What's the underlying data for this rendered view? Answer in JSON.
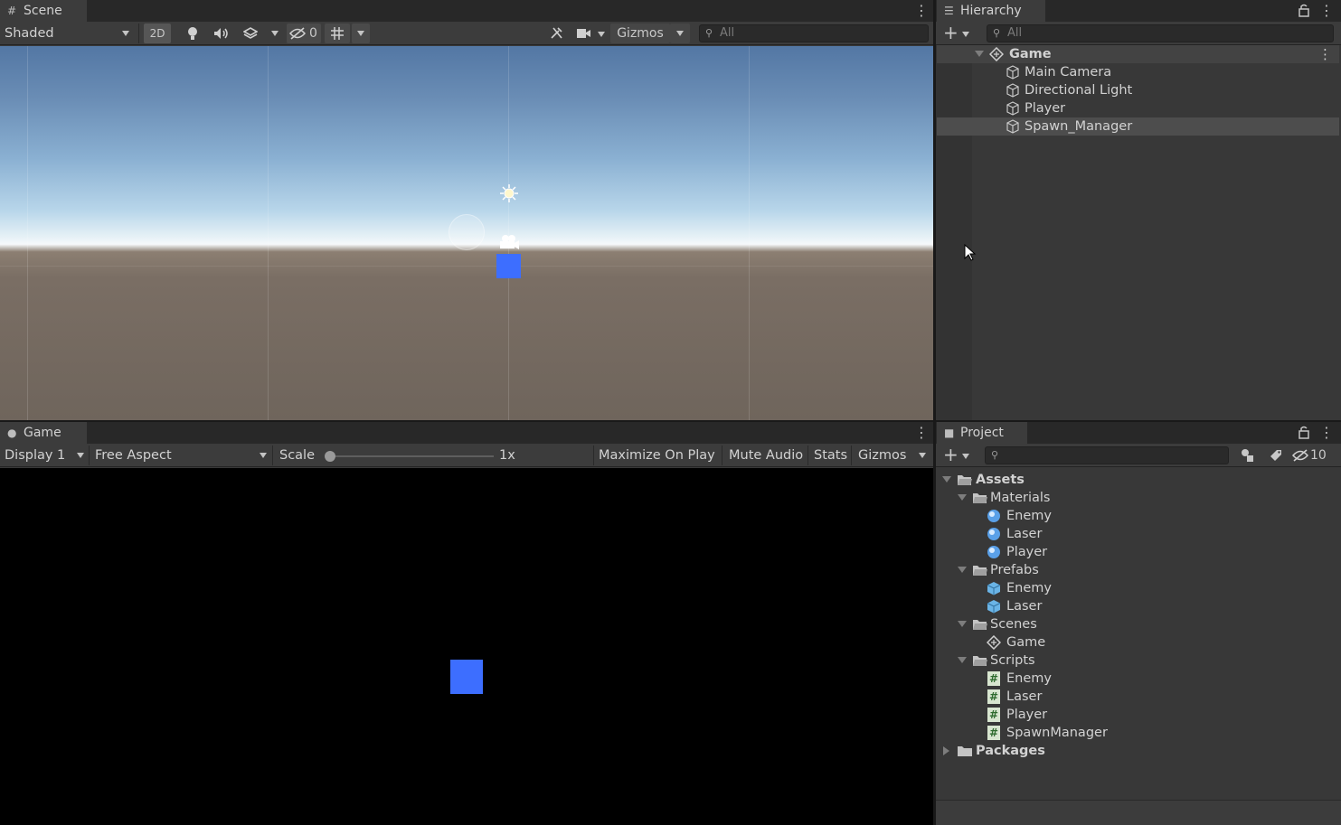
{
  "scene": {
    "tab_label": "Scene",
    "shading_mode": "Shaded",
    "btn_2d": "2D",
    "hidden_count": "0",
    "gizmos_label": "Gizmos",
    "search_placeholder": "All"
  },
  "hierarchy": {
    "tab_label": "Hierarchy",
    "search_placeholder": "All",
    "scene_name": "Game",
    "items": [
      {
        "label": "Main Camera"
      },
      {
        "label": "Directional Light"
      },
      {
        "label": "Player"
      },
      {
        "label": "Spawn_Manager"
      }
    ],
    "selected_item": "Spawn_Manager"
  },
  "game": {
    "tab_label": "Game",
    "display": "Display 1",
    "aspect": "Free Aspect",
    "scale_label": "Scale",
    "scale_value": "1x",
    "scale_slider_value": 0,
    "maximize_label": "Maximize On Play",
    "mute_label": "Mute Audio",
    "stats_label": "Stats",
    "gizmos_label": "Gizmos"
  },
  "project": {
    "tab_label": "Project",
    "hidden_packages_count": "10",
    "assets_label": "Assets",
    "packages_label": "Packages",
    "folders": [
      {
        "name": "Materials",
        "items": [
          "Enemy",
          "Laser",
          "Player"
        ],
        "icon": "material-sphere-icon"
      },
      {
        "name": "Prefabs",
        "items": [
          "Enemy",
          "Laser"
        ],
        "icon": "prefab-cube-icon"
      },
      {
        "name": "Scenes",
        "items": [
          "Game"
        ],
        "icon": "unity-scene-icon"
      },
      {
        "name": "Scripts",
        "items": [
          "Enemy",
          "Laser",
          "Player",
          "SpawnManager"
        ],
        "icon": "csharp-script-icon"
      }
    ]
  },
  "colors": {
    "panel_bg": "#383838",
    "toolbar_bg": "#3c3c3c",
    "tab_strip_bg": "#282828",
    "selection_bg": "#4d4d4d",
    "player_cube": "#3d6eff",
    "game_bg": "#000000"
  }
}
